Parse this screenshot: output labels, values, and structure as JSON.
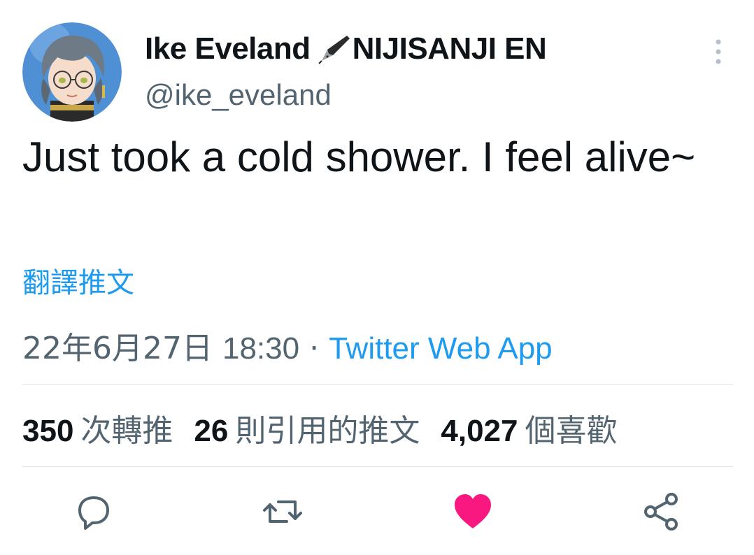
{
  "author": {
    "display_name_part1": "Ike Eveland",
    "display_name_icon": "fountain-pen-icon",
    "display_name_part2": "NIJISANJI EN",
    "handle": "@ike_eveland",
    "avatar_icon": "avatar-illustration"
  },
  "tweet": {
    "text": "Just took a cold shower. I feel alive~",
    "translate_label": "翻譯推文",
    "date": "22年6月27日",
    "time": "18:30",
    "separator": "·",
    "source": "Twitter Web App"
  },
  "stats": {
    "retweets_count": "350",
    "retweets_label": "次轉推",
    "quotes_count": "26",
    "quotes_label": "則引用的推文",
    "likes_count": "4,027",
    "likes_label": "個喜歡"
  },
  "actions": {
    "reply_icon": "reply-icon",
    "retweet_icon": "retweet-icon",
    "like_icon": "heart-icon",
    "share_icon": "share-icon",
    "more_icon": "more-vertical-icon"
  },
  "colors": {
    "link": "#1d9bf0",
    "text": "#0f1419",
    "secondary": "#536471",
    "like": "#f91880"
  }
}
